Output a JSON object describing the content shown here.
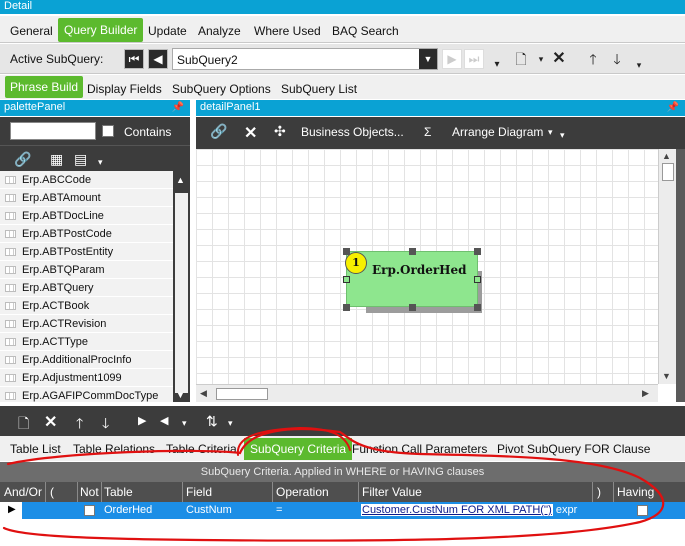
{
  "window": {
    "title": "Detail"
  },
  "main_tabs": [
    {
      "label": "General"
    },
    {
      "label": "Query Builder",
      "active": true
    },
    {
      "label": "Update"
    },
    {
      "label": "Analyze"
    },
    {
      "label": "Where Used"
    },
    {
      "label": "BAQ Search"
    }
  ],
  "subquery_bar": {
    "label": "Active SubQuery:",
    "selected": "SubQuery2"
  },
  "sub_tabs": [
    {
      "label": "Phrase Build",
      "active": true
    },
    {
      "label": "Display Fields"
    },
    {
      "label": "SubQuery Options"
    },
    {
      "label": "SubQuery List"
    }
  ],
  "palette_panel": {
    "title": "palettePanel",
    "search_value": "",
    "contains_label": "Contains",
    "items": [
      "Erp.ABCCode",
      "Erp.ABTAmount",
      "Erp.ABTDocLine",
      "Erp.ABTPostCode",
      "Erp.ABTPostEntity",
      "Erp.ABTQParam",
      "Erp.ABTQuery",
      "Erp.ACTBook",
      "Erp.ACTRevision",
      "Erp.ACTType",
      "Erp.AdditionalProcInfo",
      "Erp.Adjustment1099",
      "Erp.AGAFIPCommDocType"
    ]
  },
  "detail_panel": {
    "title": "detailPanel1",
    "toolbar": {
      "business_objects": "Business Objects...",
      "sigma": "Σ",
      "arrange": "Arrange Diagram"
    },
    "node": {
      "badge": "1",
      "title": "Erp.OrderHed"
    }
  },
  "criteria_tabs": [
    {
      "label": "Table List"
    },
    {
      "label": "Table Relations"
    },
    {
      "label": "Table Criteria"
    },
    {
      "label": "SubQuery Criteria",
      "active": true
    },
    {
      "label": "Function Call Parameters"
    },
    {
      "label": "Pivot SubQuery FOR Clause"
    }
  ],
  "criteria_grid": {
    "caption": "SubQuery Criteria. Applied in WHERE or HAVING clauses",
    "columns": [
      "And/Or",
      "(",
      "Not",
      "Table",
      "Field",
      "Operation",
      "Filter Value",
      ")",
      "Having"
    ],
    "rows": [
      {
        "and_or": "",
        "open_paren": "",
        "not": false,
        "table": "OrderHed",
        "field": "CustNum",
        "operation": "=",
        "filter_link": "Customer.CustNum FOR XML PATH('')",
        "filter_suffix": " expr",
        "close_paren": "",
        "having": false
      }
    ]
  },
  "colors": {
    "accent_green": "#5cba2e",
    "header_blue": "#0aa2d4",
    "node_green": "#8ee68e",
    "selected_row": "#1c8ee6",
    "annotation_red": "#e01010"
  }
}
